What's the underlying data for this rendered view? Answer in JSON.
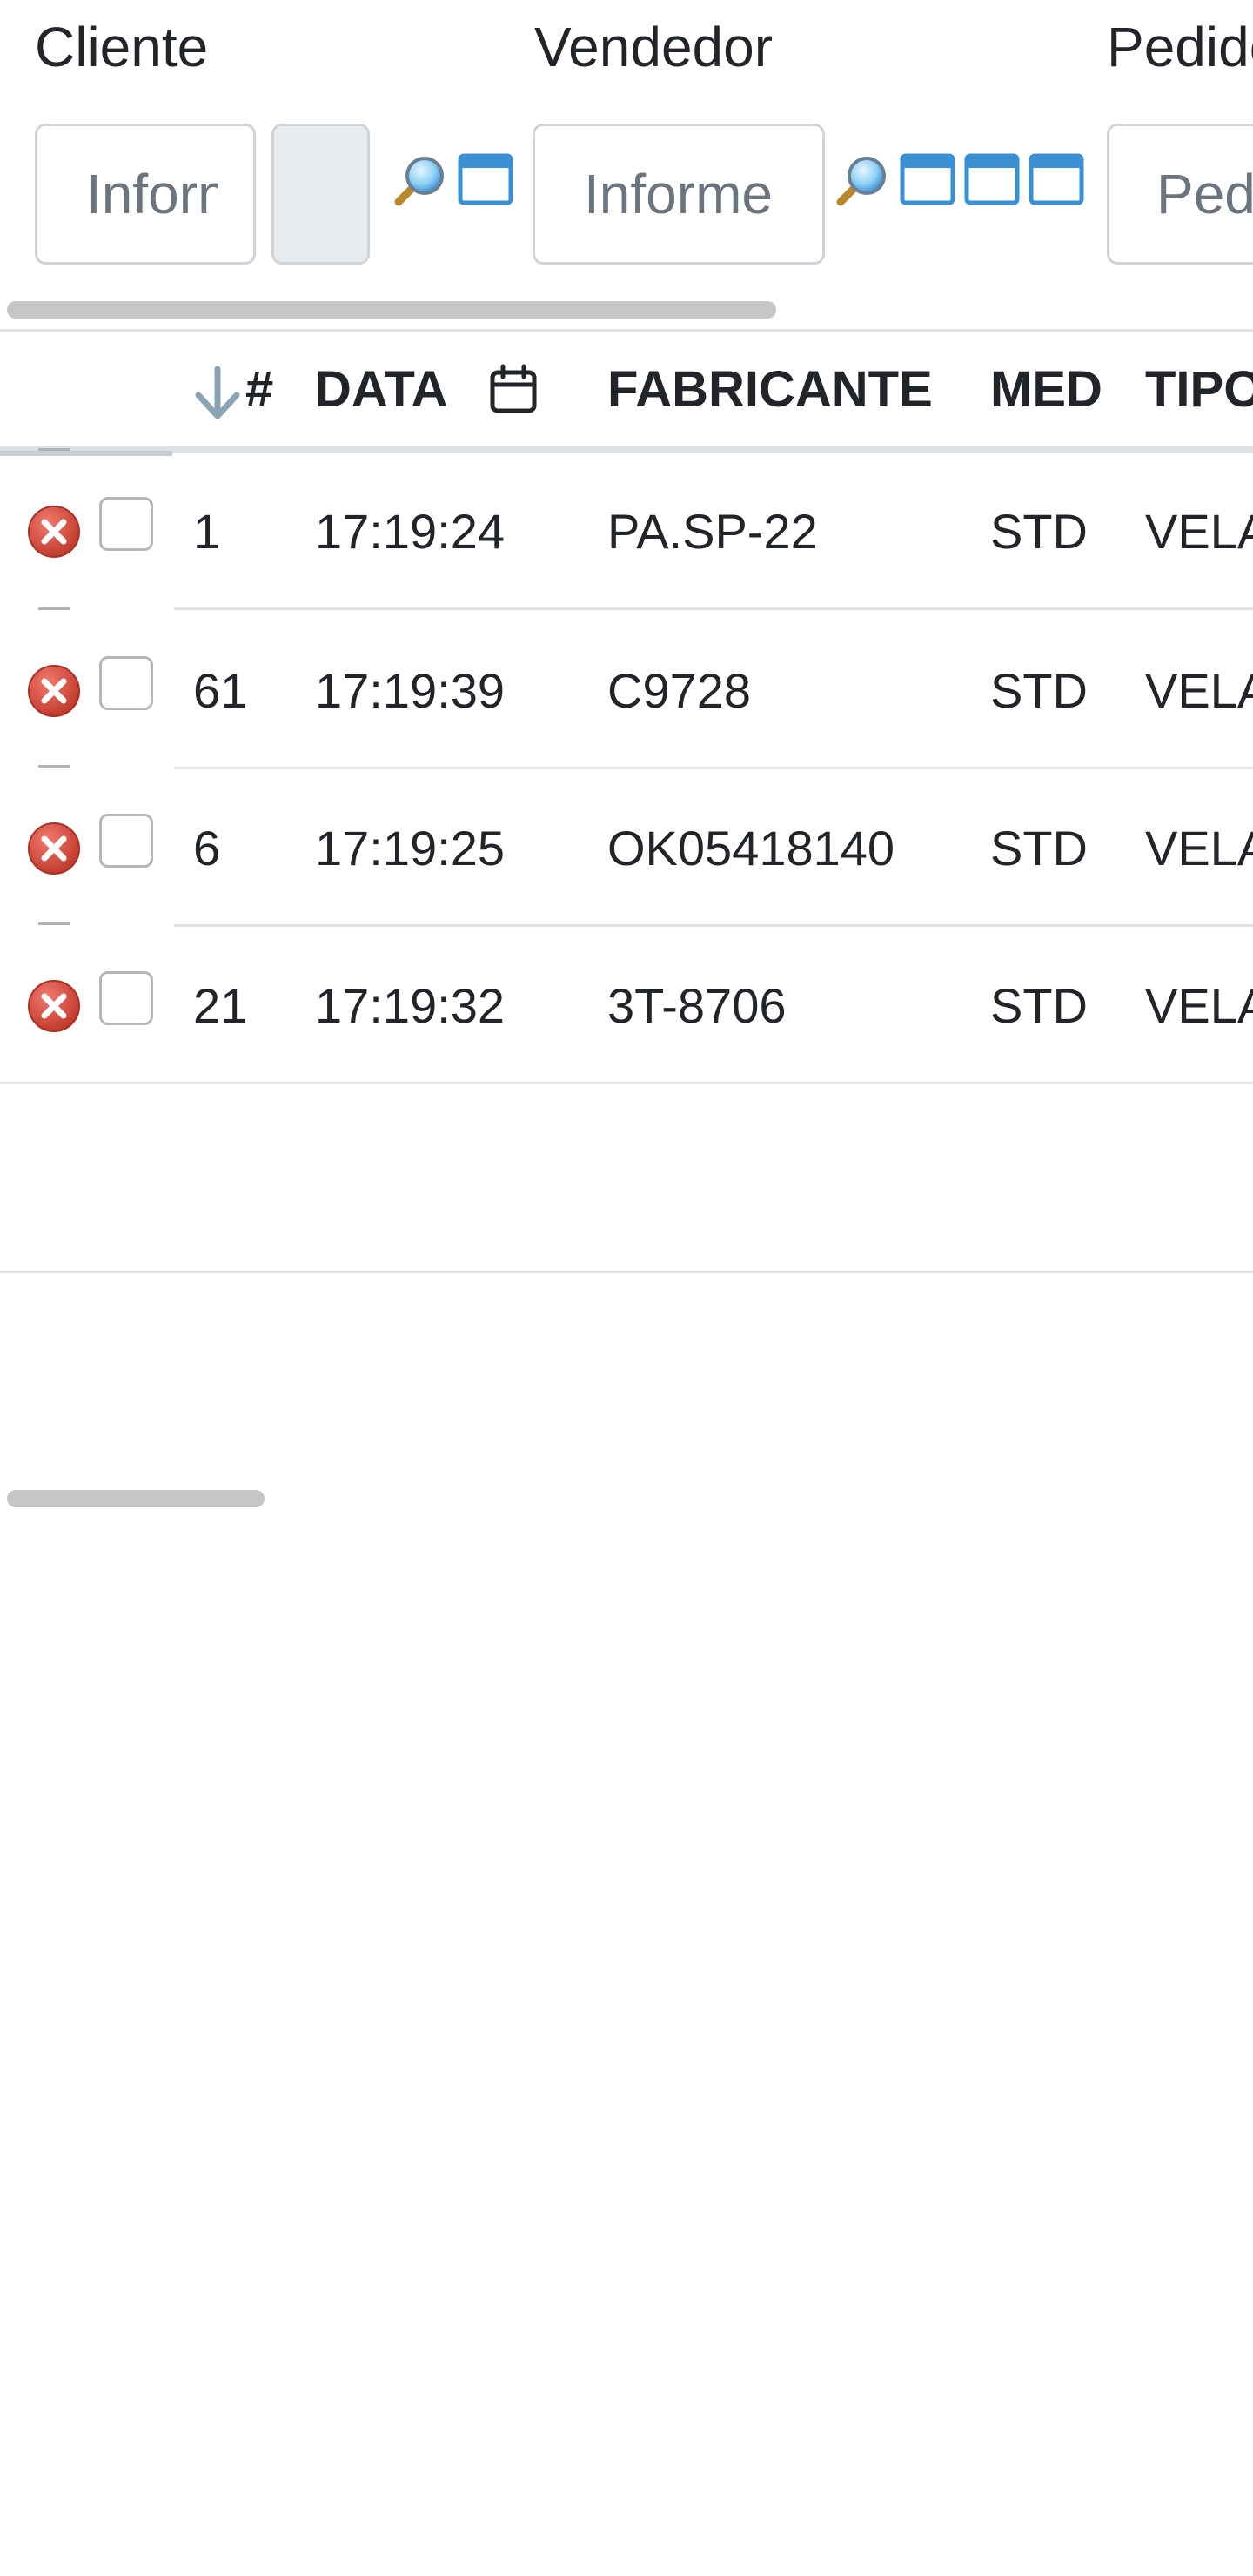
{
  "filters": {
    "cliente": {
      "label": "Cliente",
      "placeholder": "Informe o cliente",
      "code_value": ""
    },
    "vendedor": {
      "label": "Vendedor",
      "placeholder": "Informe o vendedor"
    },
    "pedido": {
      "label": "Pedido",
      "placeholder": "Pedido"
    }
  },
  "icons": {
    "lookup": "magnifier-icon",
    "window": "window-icon",
    "sort": "sort-down-arrow-icon",
    "calendar": "calendar-icon",
    "delete": "delete-circle-icon"
  },
  "table": {
    "headers": {
      "num": "#",
      "data": "DATA",
      "fabricante": "FABRICANTE",
      "med": "MED",
      "tipo": "TIPO"
    },
    "rows": [
      {
        "num": "1",
        "data": "17:19:24",
        "fabricante": "PA.SP-22",
        "med": "STD",
        "tipo": "VELA"
      },
      {
        "num": "61",
        "data": "17:19:39",
        "fabricante": "C9728",
        "med": "STD",
        "tipo": "VELA"
      },
      {
        "num": "6",
        "data": "17:19:25",
        "fabricante": "OK05418140",
        "med": "STD",
        "tipo": "VELA"
      },
      {
        "num": "21",
        "data": "17:19:32",
        "fabricante": "3T-8706",
        "med": "STD",
        "tipo": "VELA"
      }
    ]
  },
  "colors": {
    "delete_red": "#d9534f",
    "border": "#dee2e6",
    "scrollbar": "#c6c6c6",
    "window_blue": "#3b8fd4"
  }
}
